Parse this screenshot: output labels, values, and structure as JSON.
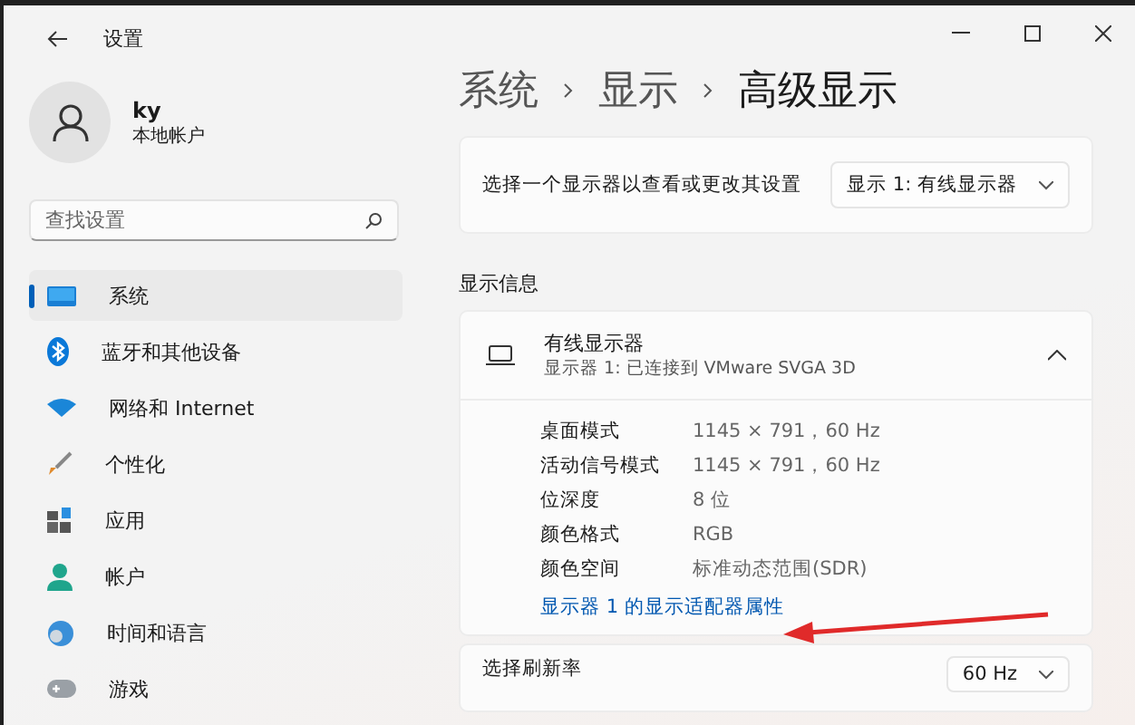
{
  "window": {
    "title": "设置"
  },
  "account": {
    "name": "ky",
    "type": "本地帐户"
  },
  "search": {
    "placeholder": "查找设置"
  },
  "sidebar": {
    "items": [
      {
        "label": "系统",
        "selected": true
      },
      {
        "label": "蓝牙和其他设备",
        "selected": false
      },
      {
        "label": "网络和 Internet",
        "selected": false
      },
      {
        "label": "个性化",
        "selected": false
      },
      {
        "label": "应用",
        "selected": false
      },
      {
        "label": "帐户",
        "selected": false
      },
      {
        "label": "时间和语言",
        "selected": false
      },
      {
        "label": "游戏",
        "selected": false
      }
    ]
  },
  "breadcrumb": [
    "系统",
    "显示",
    "高级显示"
  ],
  "display_selector": {
    "label": "选择一个显示器以查看或更改其设置",
    "value": "显示 1: 有线显示器"
  },
  "section_title": "显示信息",
  "display_info": {
    "title": "有线显示器",
    "subtitle": "显示器 1: 已连接到 VMware SVGA 3D",
    "expanded": true,
    "rows": [
      {
        "label": "桌面模式",
        "value": "1145 × 791，60 Hz"
      },
      {
        "label": "活动信号模式",
        "value": "1145 × 791，60 Hz"
      },
      {
        "label": "位深度",
        "value": "8 位"
      },
      {
        "label": "颜色格式",
        "value": "RGB"
      },
      {
        "label": "颜色空间",
        "value": "标准动态范围(SDR)"
      }
    ],
    "link": "显示器 1 的显示适配器属性"
  },
  "refresh_rate": {
    "label": "选择刷新率",
    "value": "60 Hz"
  }
}
